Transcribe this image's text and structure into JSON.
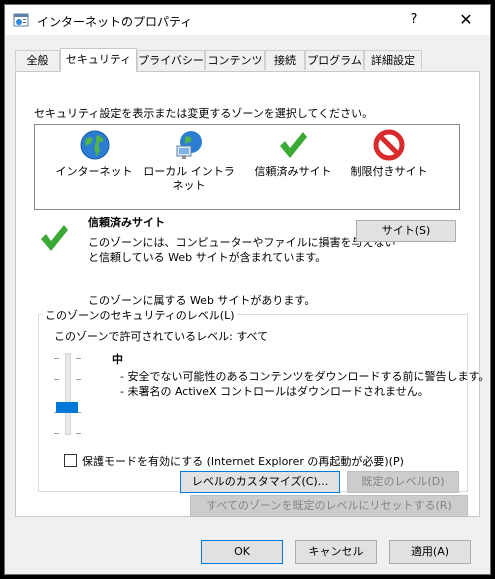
{
  "window": {
    "title": "インターネットのプロパティ",
    "help_label": "?",
    "close_label": "✕"
  },
  "tabs": [
    {
      "label": "全般"
    },
    {
      "label": "セキュリティ"
    },
    {
      "label": "プライバシー"
    },
    {
      "label": "コンテンツ"
    },
    {
      "label": "接続"
    },
    {
      "label": "プログラム"
    },
    {
      "label": "詳細設定"
    }
  ],
  "security": {
    "instruction": "セキュリティ設定を表示または変更するゾーンを選択してください。",
    "zones": [
      {
        "label": "インターネット",
        "icon": "globe-icon"
      },
      {
        "label": "ローカル イントラネット",
        "icon": "intranet-icon"
      },
      {
        "label": "信頼済みサイト",
        "icon": "checkmark-icon"
      },
      {
        "label": "制限付きサイト",
        "icon": "restricted-icon"
      }
    ],
    "selected_zone": {
      "name": "信頼済みサイト",
      "description_line1": "このゾーンには、コンピューターやファイルに損害を与えない",
      "description_line2": "と信頼している Web サイトが含まれています。",
      "sites_note": "このゾーンに属する Web サイトがあります。",
      "sites_button": "サイト(S)"
    },
    "level_group": {
      "legend": "このゾーンのセキュリティのレベル(L)",
      "allowed_levels": "このゾーンで許可されているレベル: すべて",
      "level_name": "中",
      "bullet1": "- 安全でない可能性のあるコンテンツをダウンロードする前に警告します。",
      "bullet2": "- 未署名の ActiveX コントロールはダウンロードされません。",
      "protected_mode_label": "保護モードを有効にする (Internet Explorer の再起動が必要)(P)",
      "protected_mode_checked": false,
      "custom_level_button": "レベルのカスタマイズ(C)...",
      "default_level_button": "既定のレベル(D)"
    },
    "reset_all_button": "すべてのゾーンを既定のレベルにリセットする(R)"
  },
  "footer": {
    "ok": "OK",
    "cancel": "キャンセル",
    "apply": "適用(A)"
  },
  "colors": {
    "accent": "#0078d7",
    "check_green": "#3aa935",
    "restricted_red": "#d92b2b"
  }
}
